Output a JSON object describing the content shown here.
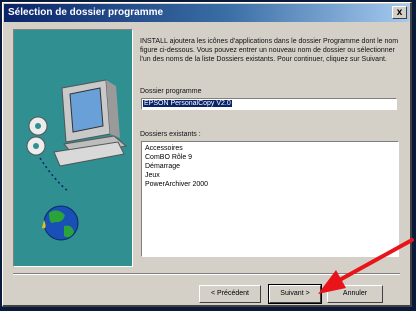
{
  "window": {
    "title": "Sélection de dossier programme",
    "close_glyph": "x"
  },
  "intro_text": "INSTALL ajoutera les icônes d'applications dans le dossier Programme dont le nom figure ci-dessous. Vous pouvez entrer un nouveau nom de dossier ou sélectionner l'un des noms de la liste Dossiers existants. Pour continuer, cliquez sur Suivant.",
  "program_folder": {
    "label": "Dossier programme",
    "value": "EPSON PersonalCopy V2.0"
  },
  "existing_folders": {
    "label": "Dossiers existants :",
    "items": [
      "Accessoires",
      "ComBO Rôle 9",
      "Démarrage",
      "Jeux",
      "PowerArchiver 2000"
    ]
  },
  "buttons": {
    "back": "< Précédent",
    "next": "Suivant >",
    "cancel": "Annuler"
  },
  "colors": {
    "title_start": "#0a246a",
    "art_background": "#2f8f91",
    "arrow": "#e8141a"
  }
}
